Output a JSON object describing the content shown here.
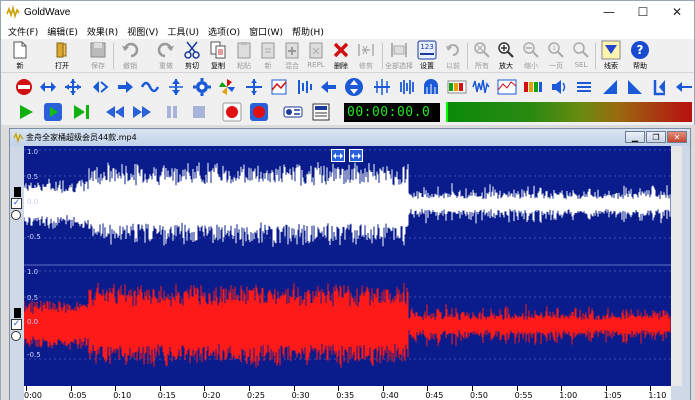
{
  "window": {
    "title": "GoldWave",
    "minimize": "—",
    "maximize": "☐",
    "close": "✕"
  },
  "menu": [
    "文件(F)",
    "编辑(E)",
    "效果(R)",
    "视图(V)",
    "工具(U)",
    "选项(O)",
    "窗口(W)",
    "帮助(H)"
  ],
  "toolbar1": [
    {
      "label": "新",
      "icon": "new-file-icon",
      "enabled": true
    },
    {
      "label": "打开",
      "icon": "open-folder-icon",
      "enabled": true
    },
    {
      "label": "保存",
      "icon": "save-icon",
      "enabled": false
    },
    {
      "label": "撤销",
      "icon": "undo-icon",
      "enabled": false
    },
    {
      "label": "重做",
      "icon": "redo-icon",
      "enabled": false
    },
    {
      "label": "剪切",
      "icon": "cut-icon",
      "enabled": true
    },
    {
      "label": "复制",
      "icon": "copy-icon",
      "enabled": true
    },
    {
      "label": "粘贴",
      "icon": "paste-icon",
      "enabled": false
    },
    {
      "label": "新",
      "icon": "paste-new-icon",
      "enabled": false
    },
    {
      "label": "混合",
      "icon": "mix-icon",
      "enabled": false
    },
    {
      "label": "REPL",
      "icon": "replace-icon",
      "enabled": false
    },
    {
      "label": "删除",
      "icon": "delete-icon",
      "enabled": true
    },
    {
      "label": "修剪",
      "icon": "trim-icon",
      "enabled": false
    },
    {
      "label": "全部选择",
      "icon": "select-all-icon",
      "enabled": false
    },
    {
      "label": "设置",
      "icon": "set-marker-icon",
      "enabled": true
    },
    {
      "label": "以前",
      "icon": "previous-icon",
      "enabled": false
    },
    {
      "label": "所有",
      "icon": "view-all-icon",
      "enabled": false
    },
    {
      "label": "放大",
      "icon": "zoom-in-icon",
      "enabled": true
    },
    {
      "label": "缩小",
      "icon": "zoom-out-icon",
      "enabled": false
    },
    {
      "label": "一页",
      "icon": "zoom-page-icon",
      "enabled": false
    },
    {
      "label": "SEL",
      "icon": "zoom-selection-icon",
      "enabled": false
    },
    {
      "label": "线索",
      "icon": "cue-icon",
      "enabled": true
    },
    {
      "label": "帮助",
      "icon": "help-icon",
      "enabled": true
    }
  ],
  "timer": "00:00:00.0",
  "file": {
    "title": "金舟全家桶超级会员44款.mp4"
  },
  "y_labels": {
    "top": [
      "1.0",
      "0.5",
      "0.0",
      "-0.5"
    ],
    "bottom": [
      "1.0",
      "0.5",
      "0.0",
      "-0.5"
    ]
  },
  "time_labels": [
    "0:00",
    "0:05",
    "0:10",
    "0:15",
    "0:20",
    "0:25",
    "0:30",
    "0:35",
    "0:40",
    "0:45",
    "0:50",
    "0:55",
    "1:00",
    "1:05",
    "1:10"
  ],
  "colors": {
    "wave_bg": "#0a1c8c",
    "left_channel": "#ffffff",
    "right_channel": "#ff1a1a",
    "timer_text": "#22e622"
  }
}
